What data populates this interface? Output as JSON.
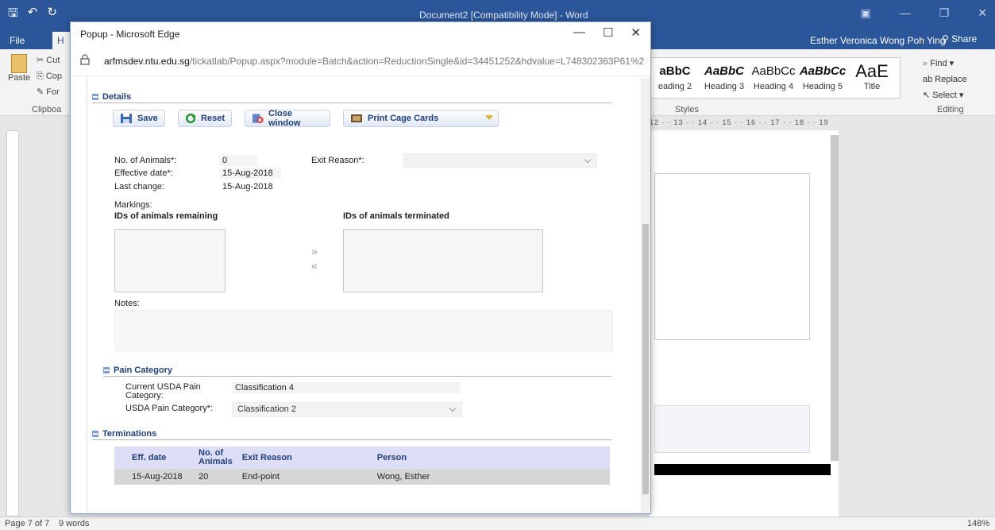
{
  "word": {
    "title": "Document2 [Compatibility Mode] - Word",
    "tab_file": "File",
    "tab_home": "H",
    "user_name": "Esther Veronica Wong Poh Ying",
    "share": "Share",
    "clipboard": {
      "cut": "Cut",
      "copy": "Cop",
      "paste": "Paste",
      "format": "For",
      "label": "Clipboa"
    },
    "styles": [
      {
        "sample": "aBbC",
        "name": "eading 2"
      },
      {
        "sample": "AaBbC",
        "name": "Heading 3"
      },
      {
        "sample": "AaBbCc",
        "name": "Heading 4"
      },
      {
        "sample": "AaBbCc",
        "name": "Heading 5"
      },
      {
        "sample": "AaE",
        "name": "Title"
      }
    ],
    "styles_label": "Styles",
    "editing": {
      "find": "Find",
      "replace": "Replace",
      "select": "Select",
      "label": "Editing"
    },
    "ruler_right": "12 · · 13 · · 14 · · 15 · · 16 · · 17 · · 18 · · 19",
    "status": {
      "page": "Page 7 of 7",
      "words": "9 words",
      "zoom": "148%"
    }
  },
  "popup": {
    "title": "Popup - Microsoft Edge",
    "url_host": "arfmsdev.ntu.edu.sg",
    "url_path": "/tickatlab/Popup.aspx?module=Batch&action=ReductionSingle&id=34451252&hdvalue=L748302363P61%2",
    "details": {
      "header": "Details",
      "buttons": {
        "save": "Save",
        "reset": "Reset",
        "close": "Close window",
        "print": "Print Cage Cards"
      },
      "no_animals_label": "No. of Animals*:",
      "no_animals_value": "0",
      "exit_reason_label": "Exit Reason*:",
      "effective_date_label": "Effective date*:",
      "effective_date_value": "15-Aug-2018",
      "last_change_label": "Last change:",
      "last_change_value": "15-Aug-2018",
      "markings_label": "Markings:",
      "ids_remaining_label": "IDs of animals remaining",
      "ids_terminated_label": "IDs of animals terminated",
      "move_right": "»",
      "move_left": "«",
      "notes_label": "Notes:"
    },
    "pain": {
      "header": "Pain Category",
      "current_label": "Current USDA Pain Category:",
      "current_value": "Classification 4",
      "category_label": "USDA Pain Category*:",
      "category_value": "Classification 2"
    },
    "terminations": {
      "header": "Terminations",
      "columns": [
        "Eff. date",
        "No. of Animals",
        "Exit Reason",
        "Person"
      ],
      "rows": [
        [
          "15-Aug-2018",
          "20",
          "End-point",
          "Wong, Esther"
        ]
      ]
    }
  },
  "colors": {
    "word_blue": "#2b579a",
    "header_blue": "#1f3f7a",
    "table_header": "#ddddf6"
  }
}
